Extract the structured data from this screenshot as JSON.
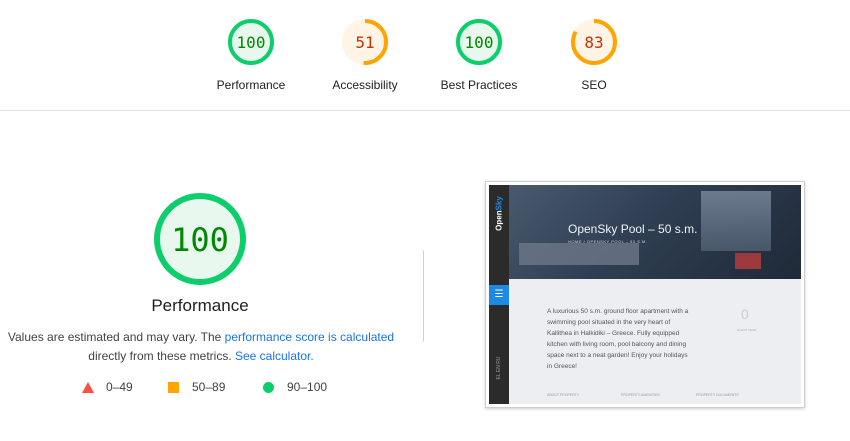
{
  "categories": [
    {
      "label": "Performance",
      "score": "100",
      "value": 100,
      "color": "#0cce6b",
      "fill": "#e8f8ee",
      "text_color": "#008800"
    },
    {
      "label": "Accessibility",
      "score": "51",
      "value": 51,
      "color": "#ffa400",
      "fill": "#fff4e5",
      "text_color": "#c33300"
    },
    {
      "label": "Best Practices",
      "score": "100",
      "value": 100,
      "color": "#0cce6b",
      "fill": "#e8f8ee",
      "text_color": "#008800"
    },
    {
      "label": "SEO",
      "score": "83",
      "value": 83,
      "color": "#ffa400",
      "fill": "#fff4e5",
      "text_color": "#c33300"
    }
  ],
  "main": {
    "score": "100",
    "value": 100,
    "title": "Performance",
    "desc_1": "Values are estimated and may vary. The ",
    "desc_link_1": "performance score is calculated",
    "desc_2": "directly from these metrics. ",
    "desc_link_2": "See calculator.",
    "legend": [
      {
        "range": "0–49",
        "shape": "triangle",
        "color": "#ff4e42"
      },
      {
        "range": "50–89",
        "shape": "square",
        "color": "#ffa400"
      },
      {
        "range": "90–100",
        "shape": "circle",
        "color": "#0cce6b"
      }
    ]
  },
  "screenshot": {
    "brand_part1": "Open",
    "brand_part2": "Sky",
    "menu_icon": "☰",
    "hero_title": "OpenSky Pool – 50 s.m.",
    "hero_crumb": "HOME / OPENSKY POOL – 50 S.M.",
    "description": "A luxurious 50 s.m. ground floor apartment with a swimming pool situated in the very heart of Kallithea in Halkidiki – Greece. Fully equipped kitchen with living room, pool balcony and dining space next to a neat garden! Enjoy your holidays in Greece!",
    "big_number": "0",
    "number_label": "GUEST YEAR",
    "languages": "EL  EN  RU",
    "footer_links": [
      "ABOUT PROPERTY",
      "PROPERTY AMENITIES",
      "PROPERTY DOCUMENTS"
    ]
  }
}
